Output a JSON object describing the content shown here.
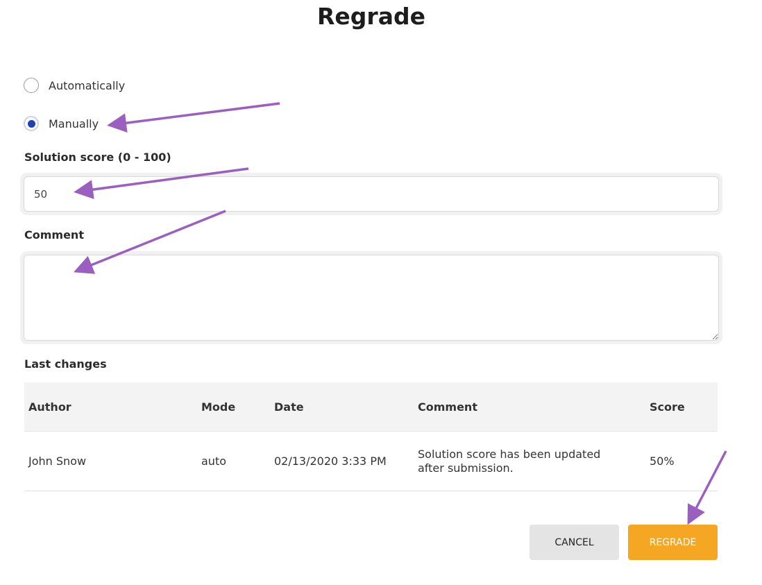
{
  "dialog": {
    "title": "Regrade"
  },
  "mode": {
    "options": [
      {
        "label": "Automatically",
        "checked": false
      },
      {
        "label": "Manually",
        "checked": true
      }
    ]
  },
  "score_field": {
    "label": "Solution score (0 - 100)",
    "value": "50"
  },
  "comment_field": {
    "label": "Comment",
    "value": ""
  },
  "history": {
    "label": "Last changes",
    "columns": [
      "Author",
      "Mode",
      "Date",
      "Comment",
      "Score"
    ],
    "rows": [
      {
        "author": "John Snow",
        "mode": "auto",
        "date": "02/13/2020 3:33 PM",
        "comment_line1": "Solution score has been updated",
        "comment_line2": "after submission.",
        "score": "50%"
      }
    ]
  },
  "actions": {
    "cancel_label": "CANCEL",
    "regrade_label": "REGRADE"
  },
  "colors": {
    "accent": "#f5a623",
    "radio_selected": "#2040b8",
    "annotation_arrow": "#9b5fc0"
  }
}
